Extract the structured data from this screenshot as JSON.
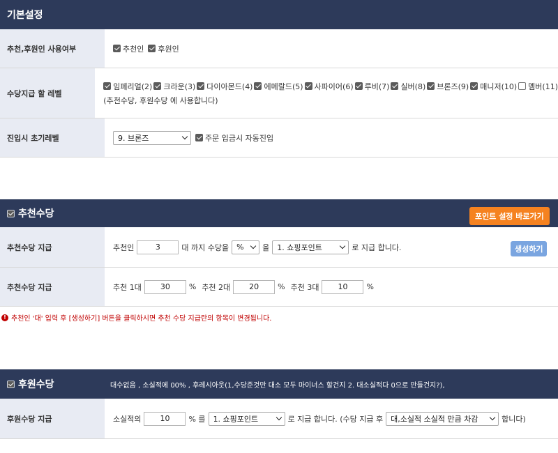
{
  "basic": {
    "header": "기본설정",
    "rows": {
      "recommend_usage": {
        "label": "추천,후원인 사용여부",
        "items": [
          {
            "text": "추천인",
            "checked": true
          },
          {
            "text": "후원인",
            "checked": true
          }
        ]
      },
      "level": {
        "label": "수당지급 할 레벨",
        "items": [
          {
            "text": "임페리얼(2)",
            "checked": true
          },
          {
            "text": "크라운(3)",
            "checked": true
          },
          {
            "text": "다이아몬드(4)",
            "checked": true
          },
          {
            "text": "에메랄드(5)",
            "checked": true
          },
          {
            "text": "사파이어(6)",
            "checked": true
          },
          {
            "text": "루비(7)",
            "checked": true
          },
          {
            "text": "실버(8)",
            "checked": true
          },
          {
            "text": "브론즈(9)",
            "checked": true
          },
          {
            "text": "매니저(10)",
            "checked": true
          },
          {
            "text": "멤버(11)",
            "checked": false
          }
        ],
        "note": "(추천수당, 후원수당 에 사용합니다)"
      },
      "initial_level": {
        "label": "진입시 초기레벨",
        "select": "9. 브론즈",
        "auto_text": "주문 입금시 자동진입",
        "auto_checked": true
      }
    }
  },
  "referral": {
    "header": "추천수당",
    "header_checked": true,
    "shortcut_button": "포인트 설정 바로가기",
    "row1": {
      "label": "추천수당 지급",
      "prefix": "추천인",
      "generations": "3",
      "mid_text": "대 까지 수당을",
      "unit_select": "%",
      "particle": "을",
      "point_select": "1. 쇼핑포인트",
      "suffix": "로 지급 합니다.",
      "generate_button": "생성하기"
    },
    "row2": {
      "label": "추천수당 지급",
      "tiers": [
        {
          "name": "추천 1대",
          "value": "30",
          "unit": "%"
        },
        {
          "name": "추천 2대",
          "value": "20",
          "unit": "%"
        },
        {
          "name": "추천 3대",
          "value": "10",
          "unit": "%"
        }
      ]
    },
    "notice": "추천인 '대' 입력 후 [생성하기] 버튼을 클릭하시면 추천 수당 지급란의 항목이 변경됩니다."
  },
  "sponsor": {
    "header": "후원수당",
    "header_checked": true,
    "header_note": "대수없음 , 소실적에 00% , 후레시아웃(1,수당준것만 대소 모두 마이너스 할건지 2. 대소실적다 0으로 만들건지?),",
    "row": {
      "label": "후원수당 지급",
      "prefix": "소실적의",
      "value": "10",
      "unit": "% 를",
      "point_select": "1. 쇼핑포인트",
      "suffix": "로 지급 합니다. (수당 지급 후",
      "deduct_select": "대,소실적 소실적 만큼 차감",
      "end": "합니다)"
    }
  },
  "colors": {
    "header_bg": "#2d3a5a",
    "label_bg": "#e8ebf3",
    "orange": "#f58220",
    "blue": "#7aa5e0",
    "notice": "#c00000"
  }
}
